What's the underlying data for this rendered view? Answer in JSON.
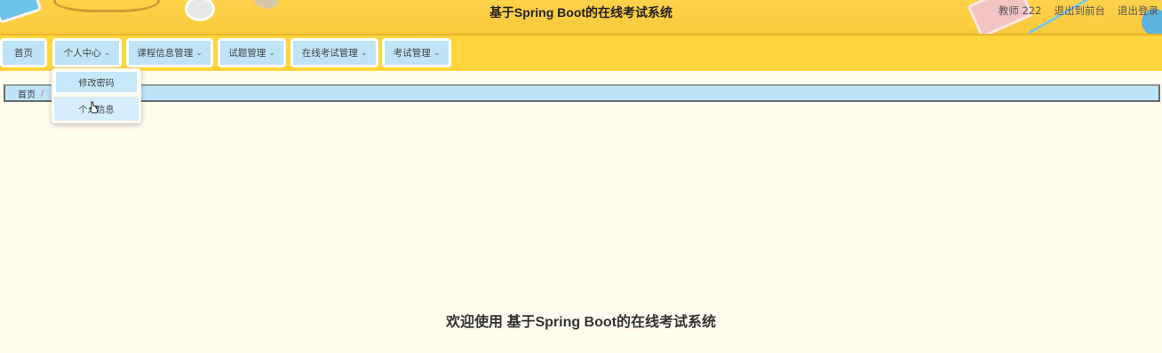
{
  "header": {
    "title": "基于Spring Boot的在线考试系统",
    "links": {
      "user": "教师 222",
      "front": "退出到前台",
      "logout": "退出登录"
    }
  },
  "nav": {
    "items": [
      {
        "label": "首页",
        "has_dropdown": false
      },
      {
        "label": "个人中心",
        "has_dropdown": true
      },
      {
        "label": "课程信息管理",
        "has_dropdown": true
      },
      {
        "label": "试题管理",
        "has_dropdown": true
      },
      {
        "label": "在线考试管理",
        "has_dropdown": true
      },
      {
        "label": "考试管理",
        "has_dropdown": true
      }
    ],
    "chevron": "chevron-down-icon"
  },
  "dropdown": {
    "parent": "个人中心",
    "items": [
      {
        "label": "修改密码"
      },
      {
        "label": "个人信息"
      }
    ]
  },
  "breadcrumb": {
    "home": "首页",
    "separator": "/"
  },
  "main": {
    "welcome": "欢迎使用 基于Spring Boot的在线考试系统"
  },
  "colors": {
    "header_bg": "#ffd24a",
    "nav_bg": "#ffd43c",
    "nav_item_bg": "#bfe3f7",
    "page_bg": "#fffbee",
    "breadcrumb_bg": "#bde4f9"
  }
}
